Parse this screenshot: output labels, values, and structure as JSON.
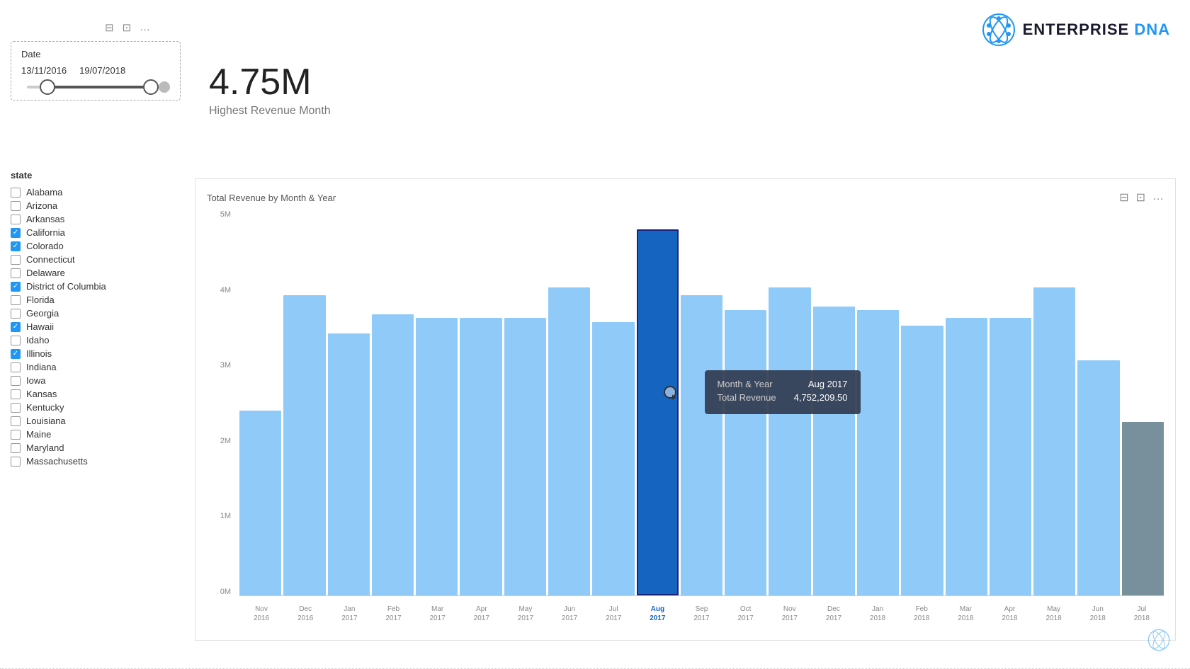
{
  "logo": {
    "text_enterprise": "ENTERPRISE",
    "text_dna": " DNA"
  },
  "date_filter": {
    "label": "Date",
    "start": "13/11/2016",
    "end": "19/07/2018"
  },
  "metric": {
    "value": "4.75M",
    "label": "Highest Revenue Month"
  },
  "state_filter": {
    "label": "state",
    "items": [
      {
        "name": "Alabama",
        "checked": false
      },
      {
        "name": "Arizona",
        "checked": false
      },
      {
        "name": "Arkansas",
        "checked": false
      },
      {
        "name": "California",
        "checked": true
      },
      {
        "name": "Colorado",
        "checked": true
      },
      {
        "name": "Connecticut",
        "checked": false
      },
      {
        "name": "Delaware",
        "checked": false
      },
      {
        "name": "District of Columbia",
        "checked": true
      },
      {
        "name": "Florida",
        "checked": false
      },
      {
        "name": "Georgia",
        "checked": false
      },
      {
        "name": "Hawaii",
        "checked": true
      },
      {
        "name": "Idaho",
        "checked": false
      },
      {
        "name": "Illinois",
        "checked": true
      },
      {
        "name": "Indiana",
        "checked": false
      },
      {
        "name": "Iowa",
        "checked": false
      },
      {
        "name": "Kansas",
        "checked": false
      },
      {
        "name": "Kentucky",
        "checked": false
      },
      {
        "name": "Louisiana",
        "checked": false
      },
      {
        "name": "Maine",
        "checked": false
      },
      {
        "name": "Maryland",
        "checked": false
      },
      {
        "name": "Massachusetts",
        "checked": false
      }
    ]
  },
  "chart": {
    "title": "Total Revenue by Month & Year",
    "y_labels": [
      "5M",
      "4M",
      "3M",
      "2M",
      "1M",
      "0M"
    ],
    "bars": [
      {
        "month": "Nov",
        "year": "2016",
        "height_pct": 48,
        "type": "normal"
      },
      {
        "month": "Dec",
        "year": "2016",
        "height_pct": 78,
        "type": "normal"
      },
      {
        "month": "Jan",
        "year": "2017",
        "height_pct": 68,
        "type": "normal"
      },
      {
        "month": "Feb",
        "year": "2017",
        "height_pct": 73,
        "type": "normal"
      },
      {
        "month": "Mar",
        "year": "2017",
        "height_pct": 72,
        "type": "normal"
      },
      {
        "month": "Apr",
        "year": "2017",
        "height_pct": 72,
        "type": "normal"
      },
      {
        "month": "May",
        "year": "2017",
        "height_pct": 72,
        "type": "normal"
      },
      {
        "month": "Jun",
        "year": "2017",
        "height_pct": 80,
        "type": "normal"
      },
      {
        "month": "Jul",
        "year": "2017",
        "height_pct": 71,
        "type": "normal"
      },
      {
        "month": "Aug",
        "year": "2017",
        "height_pct": 95,
        "type": "highlighted"
      },
      {
        "month": "Sep",
        "year": "2017",
        "height_pct": 78,
        "type": "normal"
      },
      {
        "month": "Oct",
        "year": "2017",
        "height_pct": 74,
        "type": "normal"
      },
      {
        "month": "Nov",
        "year": "2017",
        "height_pct": 80,
        "type": "normal"
      },
      {
        "month": "Dec",
        "year": "2017",
        "height_pct": 75,
        "type": "normal"
      },
      {
        "month": "Jan",
        "year": "2018",
        "height_pct": 74,
        "type": "normal"
      },
      {
        "month": "Feb",
        "year": "2018",
        "height_pct": 70,
        "type": "normal"
      },
      {
        "month": "Mar",
        "year": "2018",
        "height_pct": 72,
        "type": "normal"
      },
      {
        "month": "Apr",
        "year": "2018",
        "height_pct": 72,
        "type": "normal"
      },
      {
        "month": "May",
        "year": "2018",
        "height_pct": 80,
        "type": "normal"
      },
      {
        "month": "Jun",
        "year": "2018",
        "height_pct": 61,
        "type": "normal"
      },
      {
        "month": "Jul",
        "year": "2018",
        "height_pct": 45,
        "type": "dark"
      }
    ]
  },
  "tooltip": {
    "month_year_label": "Month & Year",
    "month_year_value": "Aug 2017",
    "revenue_label": "Total Revenue",
    "revenue_value": "4,752,209.50"
  },
  "icons": {
    "filter": "⊟",
    "export": "⊡",
    "more": "…"
  }
}
